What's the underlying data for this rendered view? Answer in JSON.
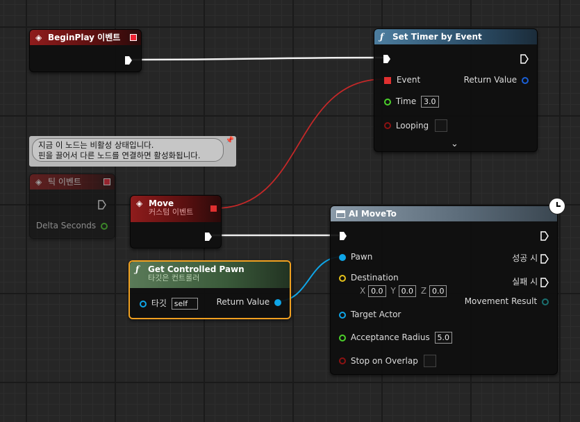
{
  "colors": {
    "exec": "#ffffff",
    "delegate": "#e03030",
    "object": "#0fa6e8",
    "vector": "#e6c21a",
    "float": "#4cd12b",
    "bool": "#8c1212",
    "struct": "#1a7070"
  },
  "tooltip": {
    "line1": "지금 이 노드는 비활성 상태입니다.",
    "line2": "핀을 끌어서 다른 노드를 연결하면 활성화됩니다."
  },
  "begin_play": {
    "title": "BeginPlay 이벤트",
    "icon": "event-diamond-icon"
  },
  "set_timer": {
    "title": "Set Timer by Event",
    "icon": "function-icon",
    "event": "Event",
    "return_value": "Return Value",
    "time": "Time",
    "time_value": "3.0",
    "looping": "Looping",
    "expand": "⌄"
  },
  "tick": {
    "title": "틱 이벤트",
    "delta": "Delta Seconds"
  },
  "move": {
    "title": "Move",
    "subtitle": "커스텀 이벤트"
  },
  "get_pawn": {
    "title": "Get Controlled Pawn",
    "subtitle": "타깃은 컨트롤러",
    "target": "타깃",
    "target_value": "self",
    "return_value": "Return Value"
  },
  "ai_moveto": {
    "title": "AI MoveTo",
    "pawn": "Pawn",
    "success": "성공 시",
    "fail": "실패 시",
    "destination": "Destination",
    "x_label": "X",
    "x": "0.0",
    "y_label": "Y",
    "y": "0.0",
    "z_label": "Z",
    "z": "0.0",
    "movement_result": "Movement Result",
    "target_actor": "Target Actor",
    "acceptance_radius": "Acceptance Radius",
    "radius_value": "5.0",
    "stop_on_overlap": "Stop on Overlap"
  }
}
